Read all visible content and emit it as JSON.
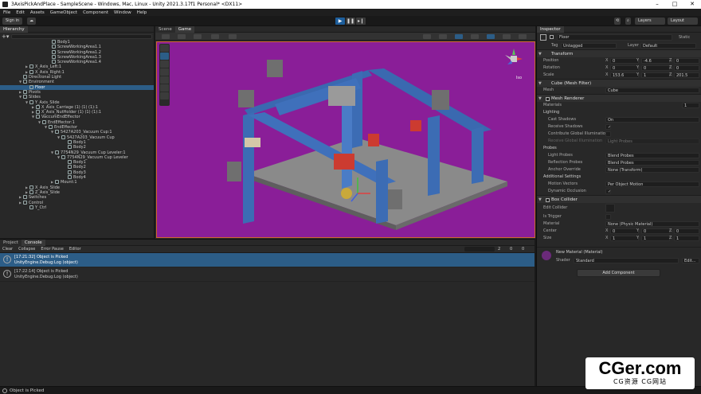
{
  "window": {
    "title": "3AxisPickAndPlace - SampleScene - Windows, Mac, Linux - Unity 2021.3.17f1 Personal* <DX11>"
  },
  "menu": [
    "File",
    "Edit",
    "Assets",
    "GameObject",
    "Component",
    "Window",
    "Help"
  ],
  "toolbar": {
    "signin": "Sign in",
    "layers": "Layers",
    "layout": "Layout"
  },
  "hierarchy": {
    "tab": "Hierarchy",
    "rows": [
      {
        "label": "Body1",
        "indent": 60,
        "sel": false,
        "arrow": ""
      },
      {
        "label": "ScrewWorkingArea1.1",
        "indent": 60,
        "sel": false,
        "arrow": ""
      },
      {
        "label": "ScrewWorkingArea1.2",
        "indent": 60,
        "sel": false,
        "arrow": ""
      },
      {
        "label": "ScrewWorkingArea1.3",
        "indent": 60,
        "sel": false,
        "arrow": ""
      },
      {
        "label": "ScrewWorkingArea1.4",
        "indent": 60,
        "sel": false,
        "arrow": ""
      },
      {
        "label": "X_Axis_Left:1",
        "indent": 32,
        "sel": false,
        "arrow": "▶"
      },
      {
        "label": "X_Axis_Right:1",
        "indent": 32,
        "sel": false,
        "arrow": "▶"
      },
      {
        "label": "Directional Light",
        "indent": 24,
        "sel": false,
        "arrow": ""
      },
      {
        "label": "Environment",
        "indent": 24,
        "sel": false,
        "arrow": "▼"
      },
      {
        "label": "Floor",
        "indent": 32,
        "sel": true,
        "arrow": ""
      },
      {
        "label": "Pivots",
        "indent": 24,
        "sel": false,
        "arrow": "▶"
      },
      {
        "label": "Slides",
        "indent": 24,
        "sel": false,
        "arrow": "▼"
      },
      {
        "label": "Y_Axis_Slide",
        "indent": 32,
        "sel": false,
        "arrow": "▼"
      },
      {
        "label": "X_Axis_Carriage (1) (1) (1):1",
        "indent": 40,
        "sel": false,
        "arrow": "▶"
      },
      {
        "label": "X_Axis_NutHolder (1) (1) (1):1",
        "indent": 40,
        "sel": false,
        "arrow": "▶"
      },
      {
        "label": "VaccumEndEffector",
        "indent": 40,
        "sel": false,
        "arrow": "▼"
      },
      {
        "label": "EndEffector:1",
        "indent": 48,
        "sel": false,
        "arrow": "▼"
      },
      {
        "label": "EndEffector",
        "indent": 56,
        "sel": false,
        "arrow": "▼"
      },
      {
        "label": "5427A203_Vacuum Cup:1",
        "indent": 64,
        "sel": false,
        "arrow": "▼"
      },
      {
        "label": "5427A203_Vacuum Cup",
        "indent": 72,
        "sel": false,
        "arrow": "▼"
      },
      {
        "label": "Body1",
        "indent": 80,
        "sel": false,
        "arrow": ""
      },
      {
        "label": "Body2",
        "indent": 80,
        "sel": false,
        "arrow": ""
      },
      {
        "label": "7754N29_Vacuum Cup Leveler:1",
        "indent": 64,
        "sel": false,
        "arrow": "▼"
      },
      {
        "label": "7754N29_Vacuum Cup Leveler",
        "indent": 72,
        "sel": false,
        "arrow": "▼"
      },
      {
        "label": "Body1",
        "indent": 80,
        "sel": false,
        "arrow": ""
      },
      {
        "label": "Body2",
        "indent": 80,
        "sel": false,
        "arrow": ""
      },
      {
        "label": "Body3",
        "indent": 80,
        "sel": false,
        "arrow": ""
      },
      {
        "label": "Body4",
        "indent": 80,
        "sel": false,
        "arrow": ""
      },
      {
        "label": "Mount:1",
        "indent": 64,
        "sel": false,
        "arrow": "▶"
      },
      {
        "label": "X_Axis_Slide",
        "indent": 32,
        "sel": false,
        "arrow": "▶"
      },
      {
        "label": "Z_Axis_Slide",
        "indent": 32,
        "sel": false,
        "arrow": "▶"
      },
      {
        "label": "Switches",
        "indent": 24,
        "sel": false,
        "arrow": "▶"
      },
      {
        "label": "Control",
        "indent": 24,
        "sel": false,
        "arrow": "▶"
      },
      {
        "label": "Y_Ctrl",
        "indent": 32,
        "sel": false,
        "arrow": ""
      }
    ]
  },
  "console": {
    "tabs": [
      "Project",
      "Console"
    ],
    "tools": [
      "Clear",
      "Collapse",
      "Error Pause",
      "Editor"
    ],
    "counts": [
      "2",
      "0",
      "0"
    ],
    "entries": [
      {
        "line1": "[17:21:32] Object is Picked",
        "line2": "UnityEngine.Debug:Log (object)"
      },
      {
        "line1": "[17:22:14] Object is Picked",
        "line2": "UnityEngine.Debug:Log (object)"
      }
    ]
  },
  "views": {
    "scene_tab": "Scene",
    "game_tab": "Game",
    "persp": "Iso"
  },
  "inspector": {
    "tab": "Inspector",
    "name": "Floor",
    "static": "Static",
    "tag_label": "Tag",
    "tag": "Untagged",
    "layer_label": "Layer",
    "layer": "Default",
    "transform": {
      "title": "Transform",
      "position": {
        "label": "Position",
        "x": "0",
        "y": "-4.6",
        "z": "0"
      },
      "rotation": {
        "label": "Rotation",
        "x": "0",
        "y": "0",
        "z": "0"
      },
      "scale": {
        "label": "Scale",
        "x": "153.6",
        "y": "1",
        "z": "201.5"
      }
    },
    "meshfilter": {
      "title": "Cube (Mesh Filter)",
      "mesh_label": "Mesh",
      "mesh": "Cube"
    },
    "renderer": {
      "title": "Mesh Renderer",
      "materials_label": "Materials",
      "materials_count": "1",
      "lighting": "Lighting",
      "cast_label": "Cast Shadows",
      "cast": "On",
      "receive_label": "Receive Shadows",
      "contrib_label": "Contribute Global Illumination",
      "receivegi_label": "Receive Global Illumination",
      "receivegi": "Light Probes",
      "probes": "Probes",
      "lightprobes_label": "Light Probes",
      "lightprobes": "Blend Probes",
      "reflection_label": "Reflection Probes",
      "reflection": "Blend Probes",
      "anchor_label": "Anchor Override",
      "anchor": "None (Transform)",
      "additional": "Additional Settings",
      "motion_label": "Motion Vectors",
      "motion": "Per Object Motion",
      "dynamic_label": "Dynamic Occlusion"
    },
    "collider": {
      "title": "Box Collider",
      "edit_label": "Edit Collider",
      "trigger_label": "Is Trigger",
      "material_label": "Material",
      "material": "None (Physic Material)",
      "center": {
        "label": "Center",
        "x": "0",
        "y": "0",
        "z": "0"
      },
      "size": {
        "label": "Size",
        "x": "1",
        "y": "1",
        "z": "1"
      }
    },
    "material": {
      "title": "New Material (Material)",
      "shader_label": "Shader",
      "shader": "Standard",
      "edit": "Edit..."
    },
    "add_component": "Add Component"
  },
  "status": "Object is Picked",
  "watermark": {
    "line1": "CGer.com",
    "line2": "CG资源 CG网站"
  },
  "colors": {
    "accent": "#2c5d87",
    "scene_bg": "#8a1e98",
    "selection_border": "#d0652f"
  }
}
